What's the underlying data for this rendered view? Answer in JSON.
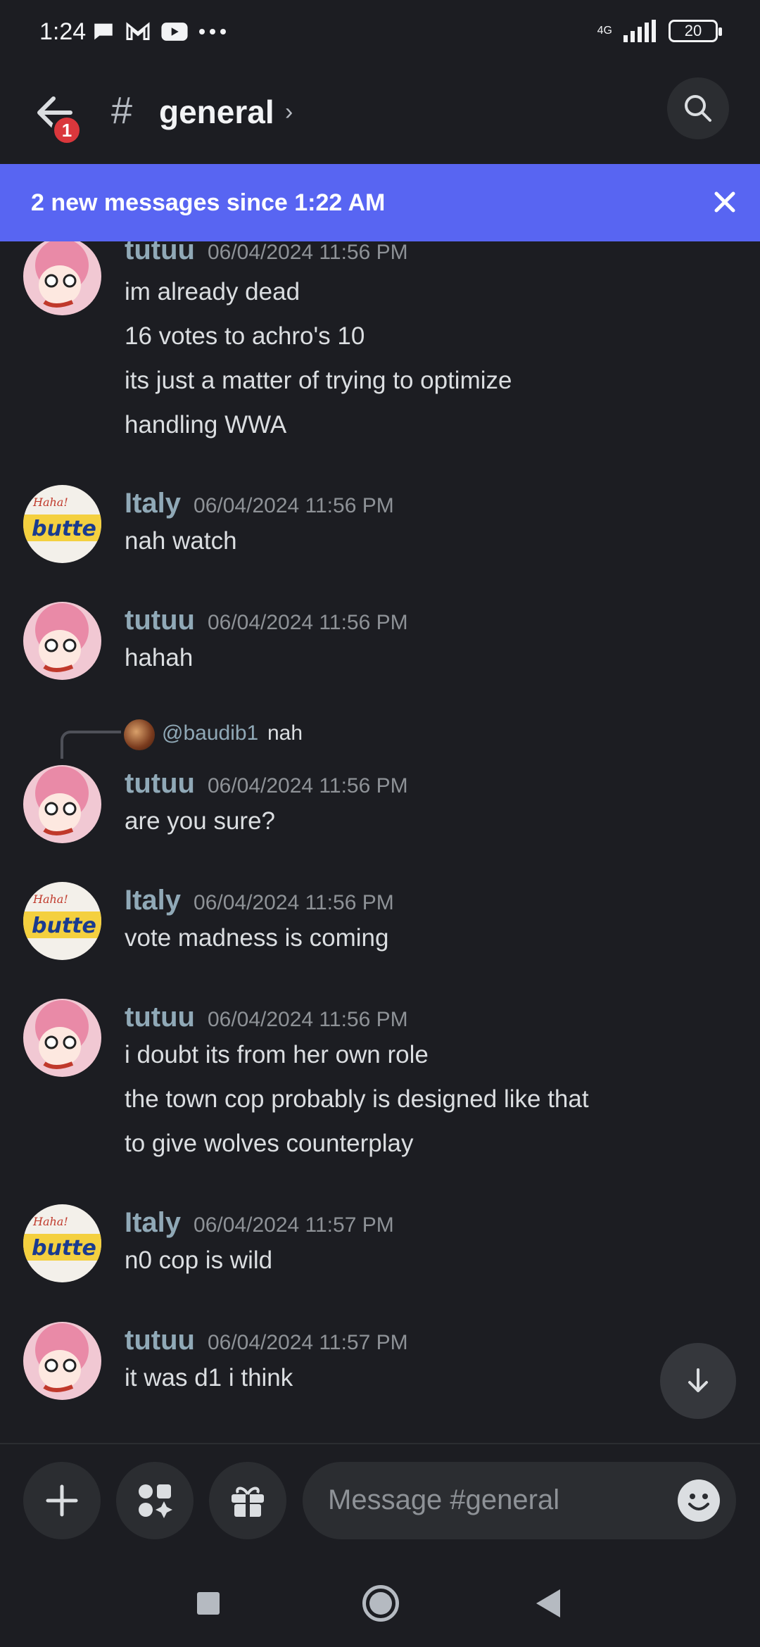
{
  "status_bar": {
    "time": "1:24",
    "left_icons": [
      "chat-icon",
      "gmail-icon",
      "youtube-icon",
      "more-dots-icon"
    ],
    "network": "4G",
    "battery": "20"
  },
  "header": {
    "channel_prefix": "#",
    "channel_name": "general",
    "chevron": "›",
    "unread_badge": "1"
  },
  "banner": {
    "text": "2 new messages since 1:22 AM",
    "color": "#5865f2"
  },
  "messages": [
    {
      "author": "tutuu",
      "timestamp": "06/04/2024 11:56 PM",
      "avatar": "pink-anime-avatar",
      "lines": [
        "im already dead",
        "16 votes to achro's 10",
        "its just a matter of trying to optimize",
        "handling WWA"
      ]
    },
    {
      "author": "Italy",
      "timestamp": "06/04/2024 11:56 PM",
      "avatar": "butter-sticker-avatar",
      "lines": [
        "nah watch"
      ]
    },
    {
      "author": "tutuu",
      "timestamp": "06/04/2024 11:56 PM",
      "avatar": "pink-anime-avatar",
      "lines": [
        "hahah"
      ]
    },
    {
      "author": "tutuu",
      "timestamp": "06/04/2024 11:56 PM",
      "avatar": "pink-anime-avatar",
      "reply": {
        "mention": "@baudib1",
        "text": "nah"
      },
      "lines": [
        "are you sure?"
      ]
    },
    {
      "author": "Italy",
      "timestamp": "06/04/2024 11:56 PM",
      "avatar": "butter-sticker-avatar",
      "lines": [
        "vote madness is coming"
      ]
    },
    {
      "author": "tutuu",
      "timestamp": "06/04/2024 11:56 PM",
      "avatar": "pink-anime-avatar",
      "lines": [
        "i doubt its from her own role",
        "the town cop probably is designed like that",
        "to give wolves counterplay"
      ]
    },
    {
      "author": "Italy",
      "timestamp": "06/04/2024 11:57 PM",
      "avatar": "butter-sticker-avatar",
      "lines": [
        "n0 cop is wild"
      ]
    },
    {
      "author": "tutuu",
      "timestamp": "06/04/2024 11:57 PM",
      "avatar": "pink-anime-avatar",
      "lines": [
        "it was d1 i think"
      ]
    }
  ],
  "composer": {
    "placeholder": "Message #general",
    "buttons": [
      "plus-icon",
      "apps-icon",
      "gift-icon"
    ]
  },
  "colors": {
    "background": "#1c1d22",
    "username": "#90a9b7",
    "message_text": "#dbdee1",
    "timestamp": "#8e9297"
  }
}
